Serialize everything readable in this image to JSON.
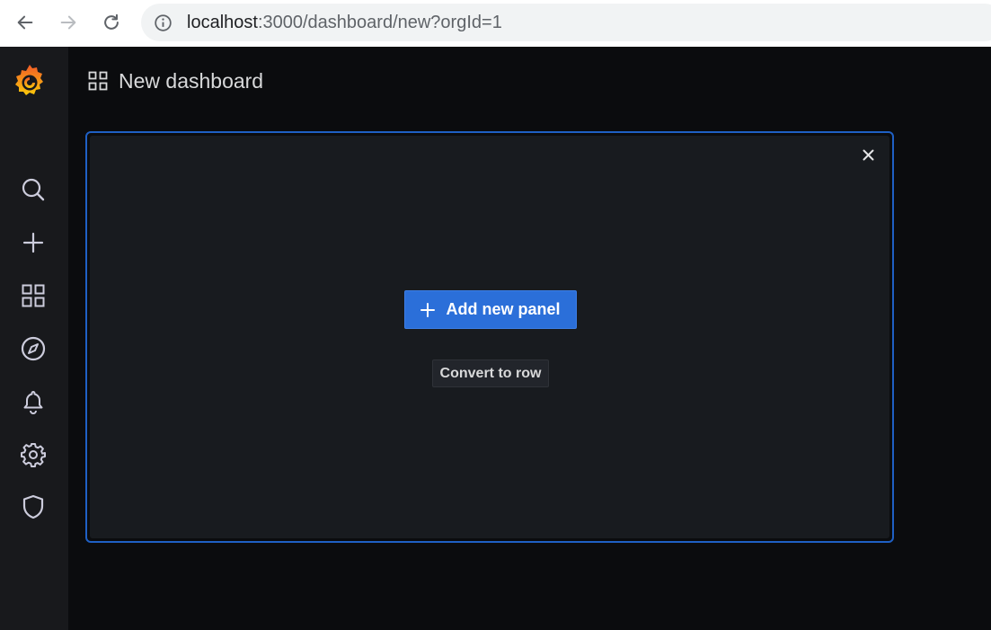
{
  "browser": {
    "url_host": "localhost",
    "url_path": ":3000/dashboard/new?orgId=1"
  },
  "sidemenu": {
    "items": [
      {
        "icon": "search-icon"
      },
      {
        "icon": "plus-icon"
      },
      {
        "icon": "dashboards-grid-icon"
      },
      {
        "icon": "compass-icon"
      },
      {
        "icon": "bell-icon"
      },
      {
        "icon": "gear-icon"
      },
      {
        "icon": "shield-icon"
      }
    ]
  },
  "header": {
    "title": "New dashboard"
  },
  "panel": {
    "add_button_label": "Add new panel",
    "convert_button_label": "Convert to row"
  },
  "colors": {
    "accent": "#1f60c4",
    "primary_button": "#2b6fd9",
    "background": "#0b0c0e",
    "sidemenu": "#18191c"
  }
}
